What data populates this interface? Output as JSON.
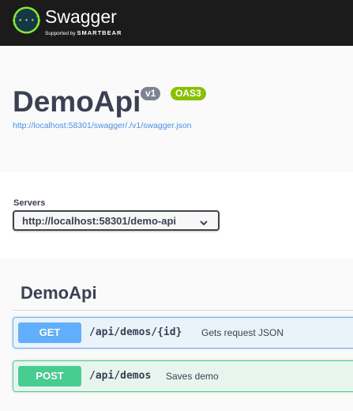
{
  "topbar": {
    "brand_name": "Swagger",
    "brand_sub_prefix": "Supported by",
    "brand_sub_company": "SMARTBEAR",
    "icon": "swagger-logo-icon",
    "logo_color": "#85ea2d"
  },
  "info": {
    "title": "DemoApi",
    "version_badge": "v1",
    "oas_badge": "OAS3",
    "spec_url": "http://localhost:58301/swagger/./v1/swagger.json"
  },
  "servers": {
    "label": "Servers",
    "selected": "http://localhost:58301/demo-api",
    "icon": "chevron-down-icon"
  },
  "tag": {
    "name": "DemoApi",
    "operations": [
      {
        "method": "GET",
        "path": "/api/demos/{id}",
        "summary": "Gets request JSON",
        "color": "#61affe"
      },
      {
        "method": "POST",
        "path": "/api/demos",
        "summary": "Saves demo",
        "color": "#49cc90"
      }
    ]
  }
}
